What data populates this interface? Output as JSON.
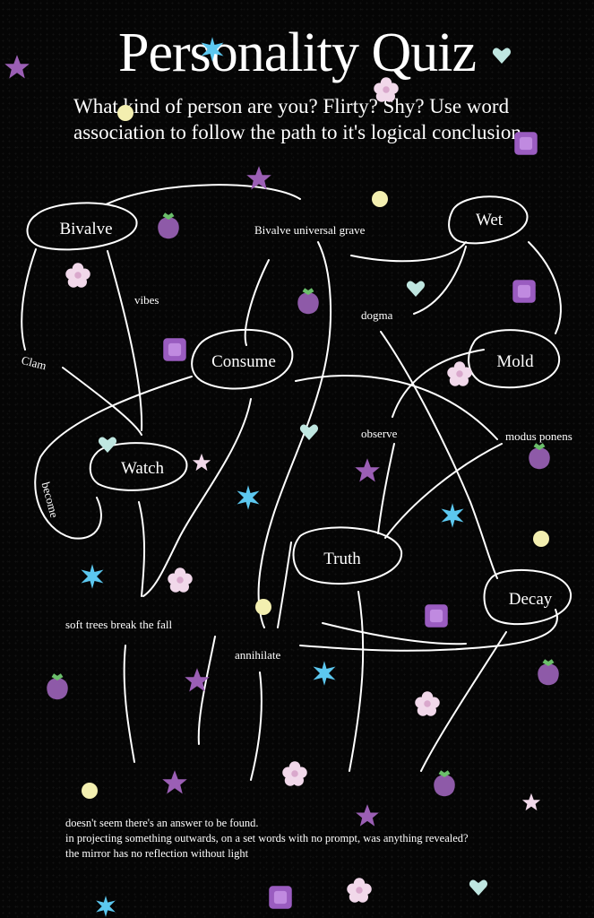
{
  "title": "Personality Quiz",
  "subtitle": {
    "line1": "What kind of person are you? Flirty? Shy? Use word",
    "line2": "association to follow the path to it's logical conclusion"
  },
  "nodes": {
    "bivalve": "Bivalve",
    "wet": "Wet",
    "consume": "Consume",
    "mold": "Mold",
    "watch": "Watch",
    "truth": "Truth",
    "decay": "Decay"
  },
  "labels": {
    "bivalve_universal_grave": "Bivalve universal grave",
    "vibes": "vibes",
    "dogma": "dogma",
    "clam": "Clam",
    "observe": "observe",
    "modus_ponens": "modus ponens",
    "become": "become",
    "soft_trees": "soft trees break the fall",
    "annihilate": "annihilate"
  },
  "ending": {
    "line1": "doesn't seem there's an answer to be found.",
    "line2": "in projecting something outwards, on a set words with no prompt, was anything revealed?",
    "line3": "the mirror has no reflection without light"
  },
  "colors": {
    "background": "#050505",
    "ink": "#ffffff",
    "star_purple": "#9b5fb5",
    "strawberry": "#8e5aa8",
    "gem_purple": "#9a5cc0",
    "sparkle_blue": "#5cc8f0",
    "dot_yellow": "#f3efb0",
    "flower": "#f1d8ea"
  },
  "decorations": [
    "star-icon",
    "strawberry-icon",
    "gem-icon",
    "sparkle-icon",
    "heart-gem-icon",
    "flower-icon",
    "dot-icon"
  ]
}
